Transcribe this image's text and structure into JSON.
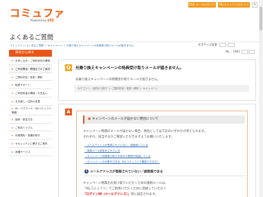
{
  "header": {
    "logo": "コミュファ",
    "logo_sub": "Powered by",
    "logo_brand": "ctc",
    "btn_webmail": "Web メールログイン",
    "btn_mycommufa": "Myコミュファログイン",
    "btn_close": "×"
  },
  "page_title": "よくあるご質問",
  "breadcrumb": "コミュファ ＞ よくあるご質問 ＞ キャンペーン ＞ 光乗り換えキャンペーンの特典受け取りメールが届きません。",
  "tools": {
    "font_size_label": "文字サイズ変更"
  },
  "sidebar": {
    "title": "目的から探す",
    "items": [
      {
        "label": "お申し込み・ご契約状況の確認",
        "icon": "▸"
      },
      {
        "label": "ご利用開始・開通までのご案内",
        "icon": "▸"
      },
      {
        "label": "ご契約内容・変更・解約",
        "icon": "▸"
      },
      {
        "label": "転居サポート",
        "icon": "▸"
      },
      {
        "label": "ご利用料金の確認・お支払い",
        "icon": "▸"
      },
      {
        "label": "お引越し・住所の変更",
        "icon": "▸"
      },
      {
        "label": "ID・パスワード・Myコミュファ関連",
        "icon": "▸"
      },
      {
        "label": "接続・設定方法",
        "icon": "▸"
      },
      {
        "label": "ご利用トラブル",
        "icon": "▸"
      },
      {
        "label": "利用規約・各種手続き",
        "icon": "▸"
      },
      {
        "label": "セキュリティに関するご案内",
        "icon": "▸"
      },
      {
        "label": "各種サービス",
        "icon": "▸"
      }
    ]
  },
  "question": {
    "number": "No. : 1963",
    "badge": "Q",
    "title": "光乗り換えキャンペーンの特典受け取りメールが届きません。",
    "text": "光乗り換えキャンペーンの特典受け取りメールが届きません。",
    "category": "カテゴリー：目的から探す ＞ ご契約内容・変更・解約 ＞ キャンペーン"
  },
  "answer": {
    "badge": "A",
    "heading": "キャンペーンのメールが届かない原因について",
    "p1": "キャンペーン特典のメールが届かない場合、原因としては下記のいずれかが考えられます。",
    "p2": "それぞれ、該当するかご確認いただきますようお願いいたします。",
    "links": [
      "・メールアドレスが登録されていない／誤登録している",
      "・迷惑メール設定をされている",
      "・キャンペーン特典受け取り手続きの期限が経過している",
      "・キャンペーンの対象外である（Myコミュファで確認できます）"
    ],
    "sub_num": "1",
    "sub_heading": "メールアドレスが登録されていない／誤登録である",
    "p3": "キャンペーン特典をお受け取りいただくための連絡メールは、",
    "p4": "「Myコミュファ」でご利用いただくために登録していただく",
    "p5_red": "「ログインID（メールアドレス）」",
    "p5_rest": "宛に送信されます。"
  }
}
